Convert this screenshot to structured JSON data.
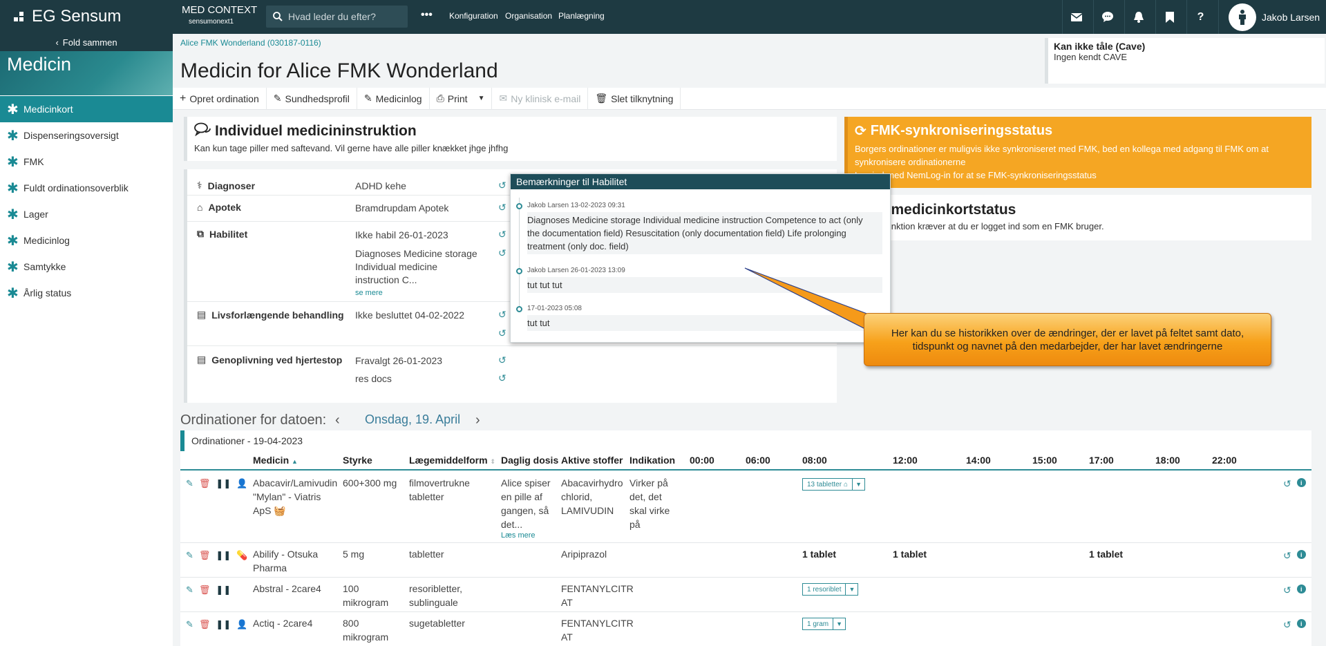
{
  "topbar": {
    "logo": "EG Sensum",
    "context_title": "MED CONTEXT",
    "context_sub": "sensumonext1",
    "search_placeholder": "Hvad leder du efter?",
    "more": "•••",
    "nav": [
      "Konfiguration",
      "Organisation",
      "Planlægning"
    ],
    "user": "Jakob Larsen"
  },
  "sidebar": {
    "fold": "Fold sammen",
    "heading": "Medicin",
    "items": [
      {
        "label": "Medicinkort",
        "active": true
      },
      {
        "label": "Dispenseringsoversigt"
      },
      {
        "label": "FMK"
      },
      {
        "label": "Fuldt ordinationsoverblik"
      },
      {
        "label": "Lager"
      },
      {
        "label": "Medicinlog"
      },
      {
        "label": "Samtykke"
      },
      {
        "label": "Årlig status"
      }
    ]
  },
  "main": {
    "breadcrumb": "Alice FMK Wonderland (030187-0116)",
    "title": "Medicin for Alice FMK Wonderland",
    "cave": {
      "heading": "Kan ikke tåle (Cave)",
      "text": "Ingen kendt CAVE"
    },
    "toolbar": {
      "create": "Opret ordination",
      "health": "Sundhedsprofil",
      "log": "Medicinlog",
      "print": "Print",
      "email": "Ny klinisk e-mail",
      "delete": "Slet tilknytning"
    },
    "instruction": {
      "heading": "Individuel medicininstruktion",
      "text": "Kan kun tage piller med saftevand. Vil gerne have alle piller knækket jhge jhfhg"
    },
    "fmk_sync": {
      "heading": "FMK-synkroniseringsstatus",
      "line1": "Borgers ordinationer er muligvis ikke synkroniseret med FMK, bed en kollega med adgang til FMK om at",
      "line2": "synkronisere ordinationerne",
      "line3": "Log ind med NemLog-in for at se FMK-synkroniseringsstatus"
    },
    "fmk_card": {
      "heading": "FMK-medicinkortstatus",
      "text": "Denne funktion kræver at du er logget ind som en FMK bruger."
    },
    "details": {
      "diag_label": "Diagnoser",
      "diag_value": "ADHD kehe",
      "apotek_label": "Apotek",
      "apotek_value": "Bramdrupdam Apotek",
      "hab_label": "Habilitet",
      "hab_value": "Ikke habil 26-01-2023",
      "hab_extra1": "Diagnoses Medicine storage",
      "hab_extra2": "Individual medicine",
      "hab_extra3": "instruction C...",
      "hab_more": "se mere",
      "liv_label": "Livsforlængende behandling",
      "liv_value": "Ikke besluttet 04-02-2022",
      "gen_label": "Genoplivning ved hjertestop",
      "gen_value": "Fravalgt 26-01-2023",
      "gen_extra": "res docs"
    },
    "popup": {
      "title": "Bemærkninger til Habilitet",
      "entries": [
        {
          "meta": "Jakob Larsen 13-02-2023 09:31",
          "l1": "Diagnoses Medicine storage Individual medicine instruction Competence to act (only",
          "l2": "the documentation field) Resuscitation (only documentation field) Life prolonging",
          "l3": "treatment (only doc. field)"
        },
        {
          "meta": "Jakob Larsen 26-01-2023 13:09",
          "l1": "tut tut tut"
        },
        {
          "meta": "17-01-2023 05:08",
          "l1": "tut tut"
        }
      ]
    },
    "callout": {
      "l1": "Her kan du se historikken over de ændringer, der er lavet på feltet samt dato,",
      "l2": "tidspunkt og navnet på den medarbejder, der har lavet ændringerne"
    },
    "ordinations": {
      "for_label": "Ordinationer for datoen:",
      "date": "Onsdag, 19. April",
      "header": "Ordinationer - 19-04-2023",
      "columns": [
        "Medicin",
        "Styrke",
        "Lægemiddelform",
        "Daglig dosis",
        "Aktive stoffer",
        "Indikation",
        "00:00",
        "06:00",
        "08:00",
        "12:00",
        "14:00",
        "15:00",
        "17:00",
        "18:00",
        "22:00"
      ],
      "rows": [
        {
          "medicin": [
            "Abacavir/Lamivudin",
            "\"Mylan\" - Viatris",
            "ApS"
          ],
          "styrke": [
            "600+300 mg"
          ],
          "form": [
            "filmovertrukne",
            "tabletter"
          ],
          "dosis": [
            "Alice spiser",
            "en pille af",
            "gangen, så",
            "det..."
          ],
          "dosis_more": "Læs mere",
          "stoffer": [
            "Abacavirhydro",
            "chlorid,",
            "LAMIVUDIN"
          ],
          "indikation": [
            "Virker på",
            "det, det",
            "skal virke",
            "på"
          ],
          "dose_0800": "13 tabletter"
        },
        {
          "medicin": [
            "Abilify - Otsuka",
            "Pharma"
          ],
          "styrke": [
            "5 mg"
          ],
          "form": [
            "tabletter"
          ],
          "stoffer": [
            "Aripiprazol"
          ],
          "dose_0800": "1 tablet",
          "dose_1200": "1 tablet",
          "dose_1700": "1 tablet"
        },
        {
          "medicin": [
            "Abstral - 2care4"
          ],
          "styrke": [
            "100",
            "mikrogram"
          ],
          "form": [
            "resoribletter,",
            "sublinguale"
          ],
          "stoffer": [
            "FENTANYLCITR",
            "AT"
          ],
          "dose_0800": "1 resoriblet"
        },
        {
          "medicin": [
            "Actiq - 2care4"
          ],
          "styrke": [
            "800",
            "mikrogram"
          ],
          "form": [
            "sugetabletter"
          ],
          "stoffer": [
            "FENTANYLCITR",
            "AT"
          ],
          "dose_0800": "1 gram"
        }
      ]
    }
  }
}
